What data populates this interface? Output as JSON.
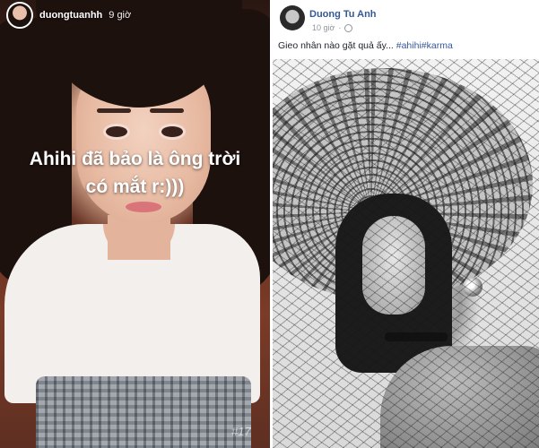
{
  "instagram_story": {
    "username": "duongtuanhh",
    "time": "9 giờ",
    "caption_line1": "Ahihi đã bảo là ông trời",
    "caption_line2": "có mắt r:)))",
    "hashtag": "#17"
  },
  "facebook_post": {
    "author": "Duong Tu Anh",
    "time": "10 giờ",
    "privacy_icon": "globe-icon",
    "text_plain": "Gieo nhân nào gặt quả ấy... ",
    "hashtag_1": "#ahihi",
    "hashtag_2": "#karma"
  },
  "colors": {
    "fb_link": "#365899",
    "fb_meta": "#90949c",
    "fb_text": "#1d2129"
  }
}
